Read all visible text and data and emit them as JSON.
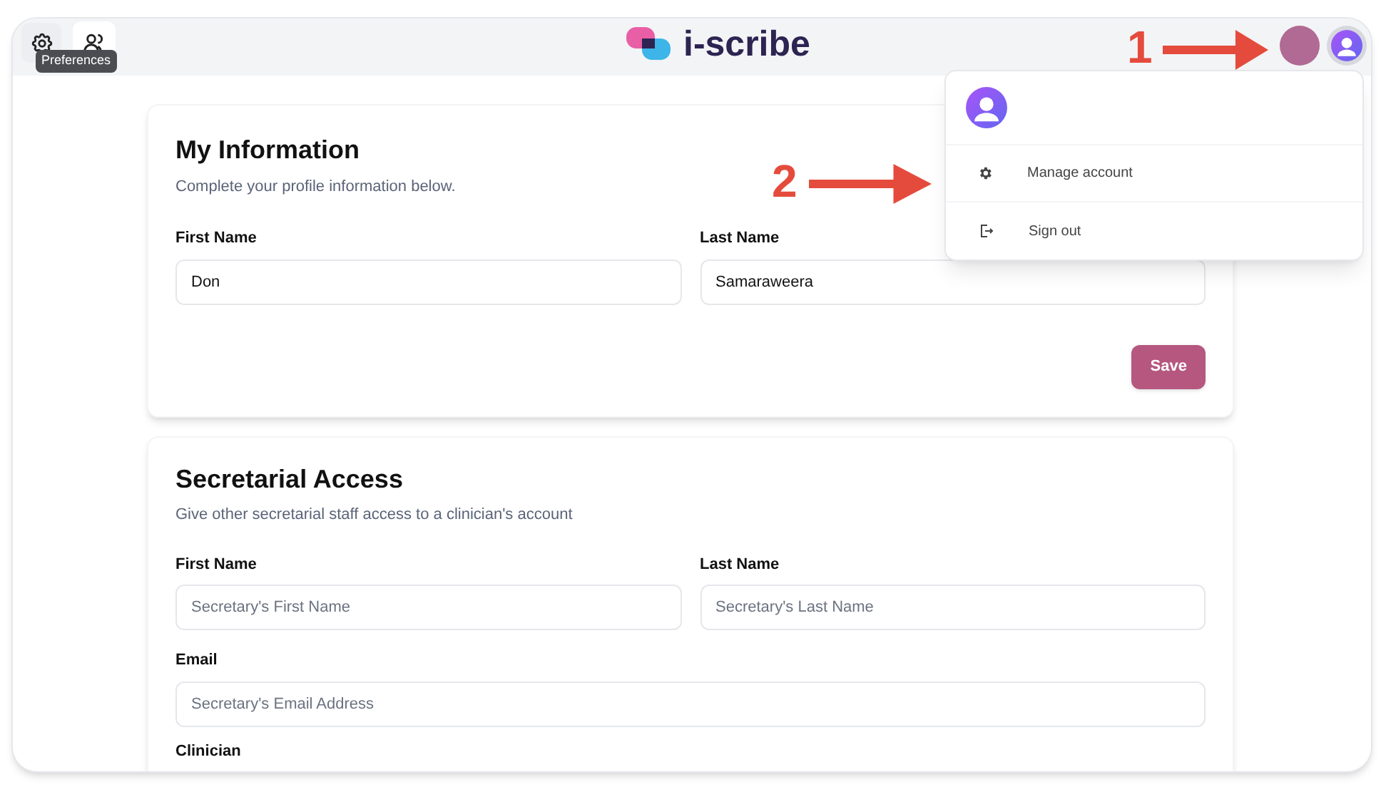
{
  "header": {
    "tooltip": "Preferences",
    "logo": "i-scribe"
  },
  "user_menu": {
    "items": [
      {
        "label": "Manage account"
      },
      {
        "label": "Sign out"
      }
    ]
  },
  "info_card": {
    "title": "My Information",
    "subtitle": "Complete your profile information below.",
    "fields": [
      {
        "label": "First Name",
        "value": "Don"
      },
      {
        "label": "Last Name",
        "value": "Samaraweera"
      }
    ],
    "button": "Save"
  },
  "access_card": {
    "title": "Secretarial Access",
    "subtitle": "Give other secretarial staff access to a clinician's account",
    "rows": [
      [
        {
          "label": "First Name",
          "placeholder": "Secretary's First Name"
        },
        {
          "label": "Last Name",
          "placeholder": "Secretary's Last Name"
        }
      ],
      [
        {
          "label": "Email",
          "placeholder": "Secretary's Email Address"
        }
      ]
    ],
    "last_label": "Clinician"
  },
  "annotations": [
    {
      "text": "1"
    },
    {
      "text": "2"
    }
  ]
}
